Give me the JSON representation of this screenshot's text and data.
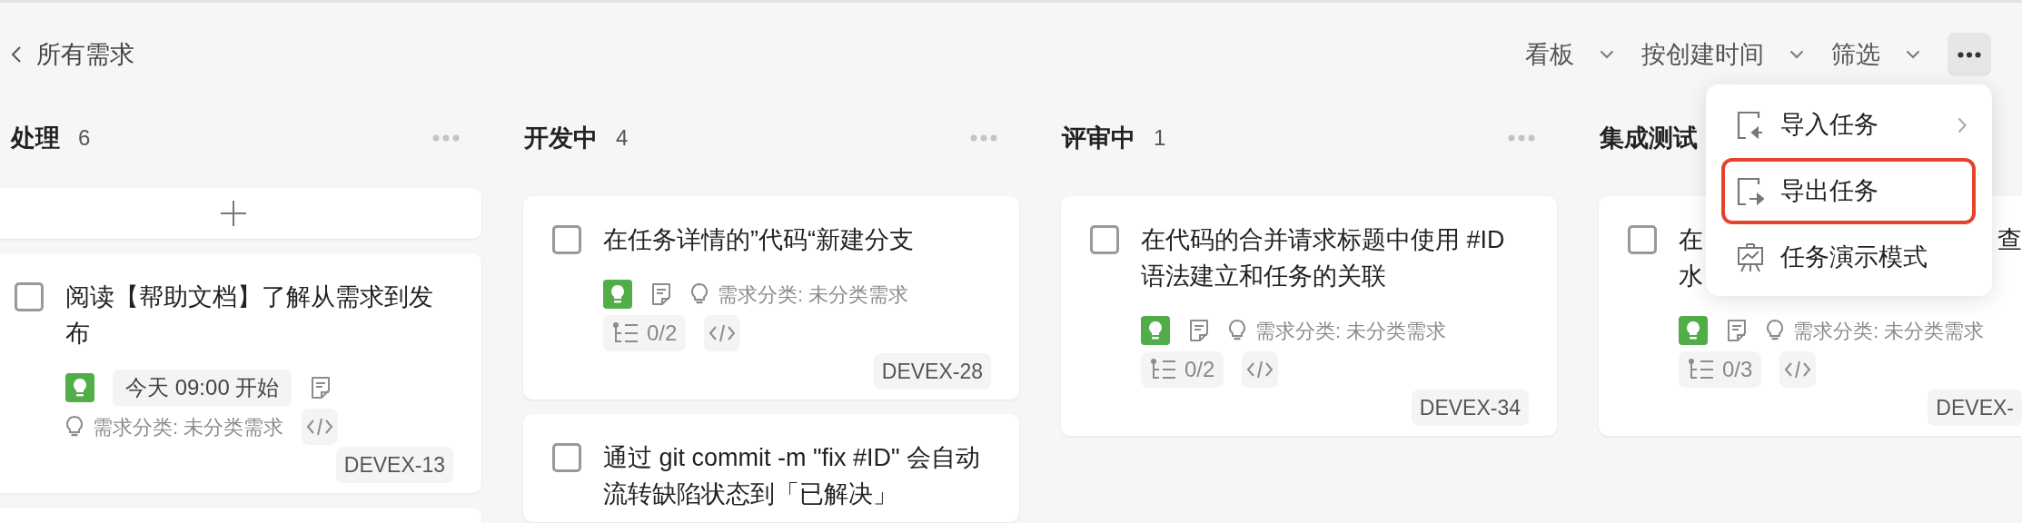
{
  "breadcrumb": {
    "title": "所有需求"
  },
  "toolbar": [
    {
      "label": "看板"
    },
    {
      "label": "按创建时间"
    },
    {
      "label": "筛选"
    }
  ],
  "more_button": {
    "active": true
  },
  "columns": [
    {
      "name": "处理",
      "count": "6",
      "add_button": true,
      "more_cards_below": true,
      "cards": [
        {
          "title": "阅读【帮助文档】了解从需求到发布",
          "checked": false,
          "badges": [
            {
              "kind": "type"
            },
            {
              "kind": "date",
              "text": "今天 09:00 开始"
            },
            {
              "kind": "doc"
            },
            {
              "kind": "category",
              "text": "需求分类: 未分类需求"
            },
            {
              "kind": "code"
            }
          ],
          "id": "DEVEX-13"
        }
      ]
    },
    {
      "name": "开发中",
      "count": "4",
      "add_button": false,
      "cards": [
        {
          "title": "在任务详情的”代码“新建分支",
          "checked": false,
          "badges": [
            {
              "kind": "type"
            },
            {
              "kind": "doc"
            },
            {
              "kind": "category",
              "text": "需求分类: 未分类需求"
            },
            {
              "kind": "subtasks",
              "text": "0/2"
            },
            {
              "kind": "code"
            }
          ],
          "id": "DEVEX-28"
        },
        {
          "title": "通过 git commit -m \"fix #ID\" 会自动流转缺陷状态到「已解决」",
          "checked": false
        }
      ]
    },
    {
      "name": "评审中",
      "count": "1",
      "add_button": false,
      "cards": [
        {
          "title": "在代码的合并请求标题中使用 #ID 语法建立和任务的关联",
          "checked": false,
          "badges": [
            {
              "kind": "type"
            },
            {
              "kind": "doc"
            },
            {
              "kind": "category",
              "text": "需求分类: 未分类需求"
            },
            {
              "kind": "subtasks",
              "text": "0/2"
            },
            {
              "kind": "code"
            }
          ],
          "id": "DEVEX-34"
        }
      ]
    },
    {
      "name": "集成测试",
      "add_button": false,
      "cards": [
        {
          "title_fragments": [
            "在",
            "查",
            "水"
          ],
          "checked": false,
          "badges": [
            {
              "kind": "type"
            },
            {
              "kind": "doc"
            },
            {
              "kind": "category",
              "text": "需求分类: 未分类需求"
            },
            {
              "kind": "subtasks",
              "text": "0/3"
            },
            {
              "kind": "code"
            }
          ],
          "id": "DEVEX-"
        }
      ]
    }
  ],
  "menu": {
    "items": [
      {
        "kind": "import",
        "label": "导入任务",
        "submenu": true,
        "highlighted": false
      },
      {
        "kind": "export",
        "label": "导出任务",
        "submenu": false,
        "highlighted": true
      },
      {
        "kind": "present",
        "label": "任务演示模式",
        "submenu": false,
        "highlighted": false
      }
    ]
  }
}
